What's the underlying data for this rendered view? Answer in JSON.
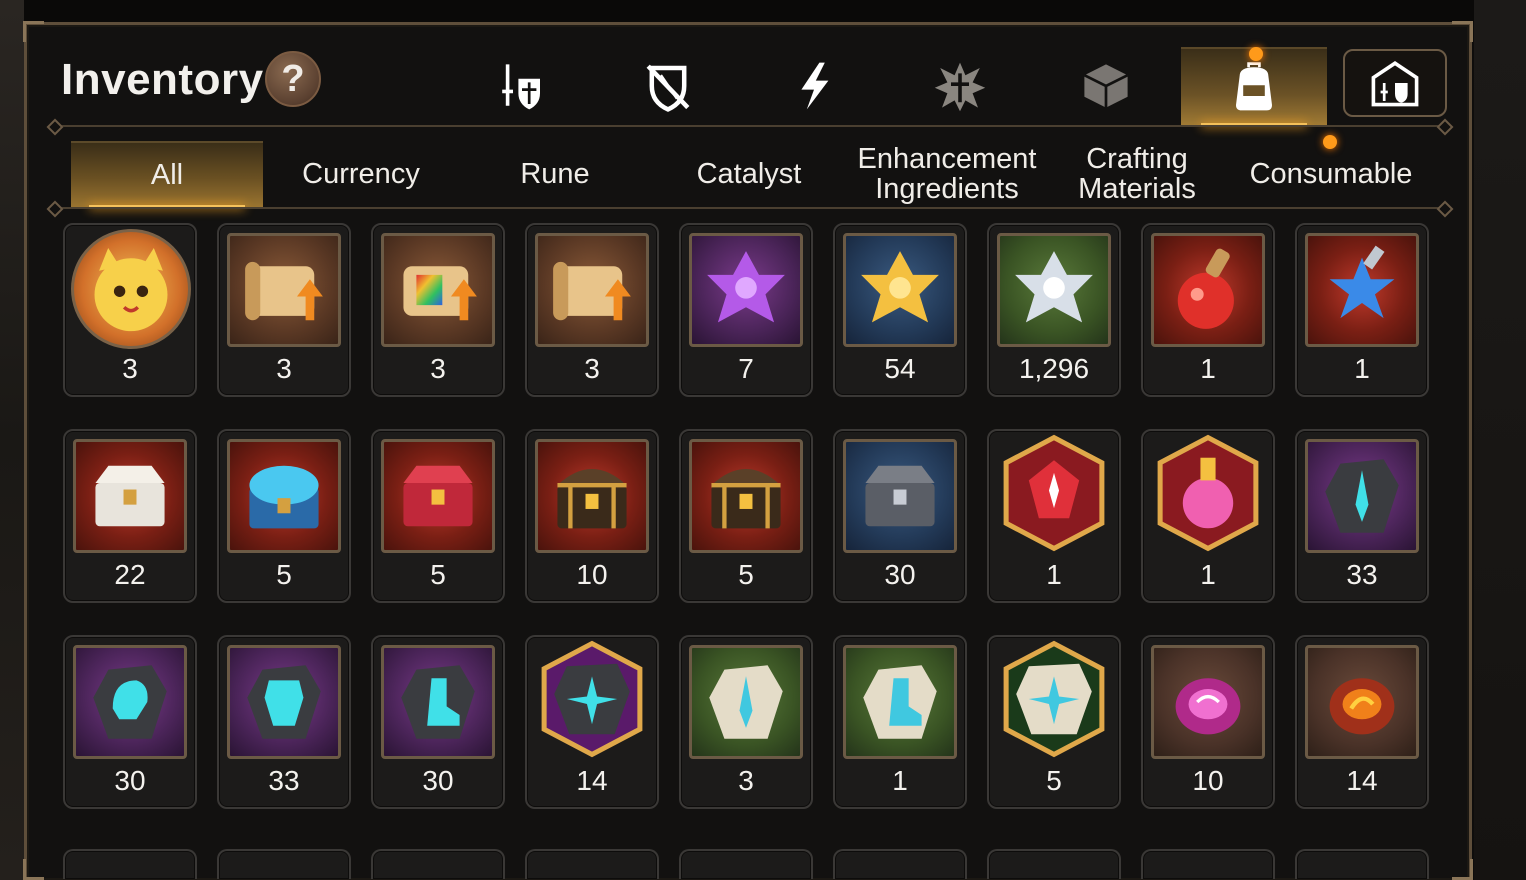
{
  "title": "Inventory",
  "help_label": "?",
  "categories": [
    {
      "name": "equipment",
      "icon": "sword-shield-icon"
    },
    {
      "name": "artifact",
      "icon": "crossed-shield-icon"
    },
    {
      "name": "energy",
      "icon": "lightning-icon"
    },
    {
      "name": "imprint",
      "icon": "star-burst-icon"
    },
    {
      "name": "dice",
      "icon": "cube-icon"
    },
    {
      "name": "bag",
      "icon": "backpack-icon",
      "active": true
    },
    {
      "name": "storage",
      "icon": "armory-icon"
    }
  ],
  "tabs": [
    {
      "label": "All",
      "active": true
    },
    {
      "label": "Currency"
    },
    {
      "label": "Rune"
    },
    {
      "label": "Catalyst"
    },
    {
      "label": "Enhancement Ingredients"
    },
    {
      "label": "Crafting Materials"
    },
    {
      "label": "Consumable"
    }
  ],
  "items": [
    {
      "icon": "cat-mascot-icon",
      "qty": "3",
      "bg": "round"
    },
    {
      "icon": "scroll-upgrade-icon",
      "qty": "3",
      "bg": "orange"
    },
    {
      "icon": "rainbow-scroll-icon",
      "qty": "3",
      "bg": "orange"
    },
    {
      "icon": "scroll-upgrade-icon",
      "qty": "3",
      "bg": "orange"
    },
    {
      "icon": "purple-crystal-flower-icon",
      "qty": "7",
      "bg": "purple"
    },
    {
      "icon": "gold-crystal-flower-icon",
      "qty": "54",
      "bg": "blue"
    },
    {
      "icon": "silver-crystal-flower-icon",
      "qty": "1,296",
      "bg": "green"
    },
    {
      "icon": "red-potion-icon",
      "qty": "1",
      "bg": "red"
    },
    {
      "icon": "star-potion-icon",
      "qty": "1",
      "bg": "red"
    },
    {
      "icon": "silver-chest-icon",
      "qty": "22",
      "bg": "red"
    },
    {
      "icon": "blue-chest-icon",
      "qty": "5",
      "bg": "red"
    },
    {
      "icon": "red-chest-icon",
      "qty": "5",
      "bg": "red"
    },
    {
      "icon": "gold-chest-icon",
      "qty": "10",
      "bg": "red"
    },
    {
      "icon": "gold-chest-icon",
      "qty": "5",
      "bg": "red"
    },
    {
      "icon": "iron-chest-icon",
      "qty": "30",
      "bg": "blue"
    },
    {
      "icon": "red-rune-hex-icon",
      "qty": "1",
      "bg": "hex-red"
    },
    {
      "icon": "pink-potion-hex-icon",
      "qty": "1",
      "bg": "hex-red"
    },
    {
      "icon": "teal-sword-rune-icon",
      "qty": "33",
      "bg": "purple"
    },
    {
      "icon": "teal-helm-rune-icon",
      "qty": "30",
      "bg": "purple"
    },
    {
      "icon": "teal-armor-rune-icon",
      "qty": "33",
      "bg": "purple"
    },
    {
      "icon": "teal-boot-rune-icon",
      "qty": "30",
      "bg": "purple"
    },
    {
      "icon": "teal-star-rune-hex-icon",
      "qty": "14",
      "bg": "hex-purple"
    },
    {
      "icon": "stone-sword-rune-icon",
      "qty": "3",
      "bg": "green"
    },
    {
      "icon": "stone-boot-rune-icon",
      "qty": "1",
      "bg": "green"
    },
    {
      "icon": "stone-star-rune-hex-icon",
      "qty": "5",
      "bg": "hex-green"
    },
    {
      "icon": "pink-disc-icon",
      "qty": "10",
      "bg": "brown"
    },
    {
      "icon": "fire-disc-icon",
      "qty": "14",
      "bg": "brown"
    }
  ],
  "colors": {
    "accent": "#f4c05a",
    "panel_border": "#5e4e3a",
    "notification": "#ff9a1a"
  }
}
